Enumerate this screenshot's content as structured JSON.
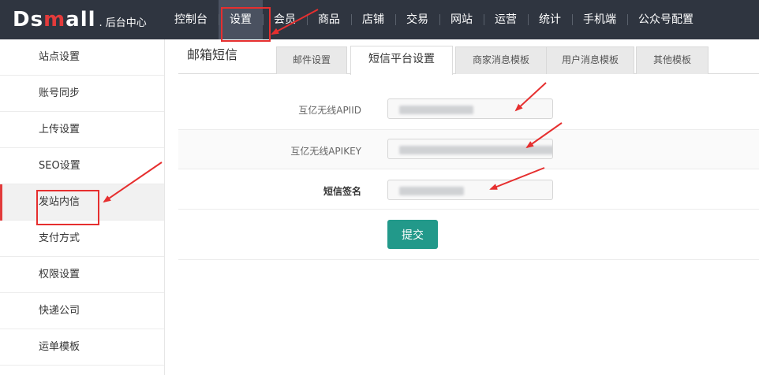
{
  "header": {
    "brand": "Dsmall",
    "subtitle": ". 后台中心",
    "nav": [
      "控制台",
      "设置",
      "会员",
      "商品",
      "店铺",
      "交易",
      "网站",
      "运营",
      "统计",
      "手机端",
      "公众号配置"
    ],
    "active_nav": "设置"
  },
  "sidebar": {
    "items": [
      "站点设置",
      "账号同步",
      "上传设置",
      "SEO设置",
      "发站内信",
      "支付方式",
      "权限设置",
      "快递公司",
      "运单模板"
    ],
    "active": "发站内信"
  },
  "main": {
    "title": "邮箱短信",
    "tabs": [
      "邮件设置",
      "短信平台设置",
      "商家消息模板",
      "用户消息模板",
      "其他模板"
    ],
    "active_tab": "短信平台设置",
    "fields": [
      {
        "label": "互亿无线APIID",
        "value": ""
      },
      {
        "label": "互亿无线APIKEY",
        "value": ""
      },
      {
        "label": "短信签名",
        "value": ""
      }
    ],
    "submit_label": "提交"
  },
  "colors": {
    "topbar": "#2f3540",
    "accent_red": "#e62f2f",
    "submit": "#22998a"
  }
}
